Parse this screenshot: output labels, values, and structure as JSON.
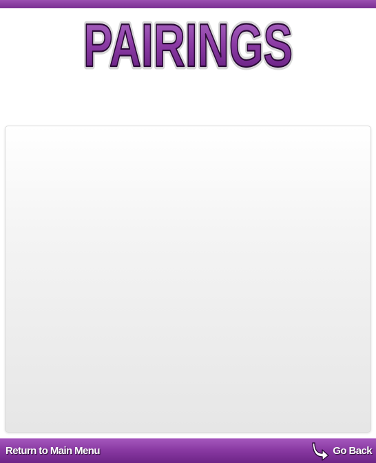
{
  "header": {
    "title": "PAIRINGS"
  },
  "footer": {
    "return_label": "Return to Main Menu",
    "back_label": "Go Back",
    "back_icon": "curved-arrow-icon"
  },
  "colors": {
    "accent": "#8a3aa3",
    "title_fill_top": "#a35fbd",
    "title_fill_bottom": "#6a1f86"
  }
}
